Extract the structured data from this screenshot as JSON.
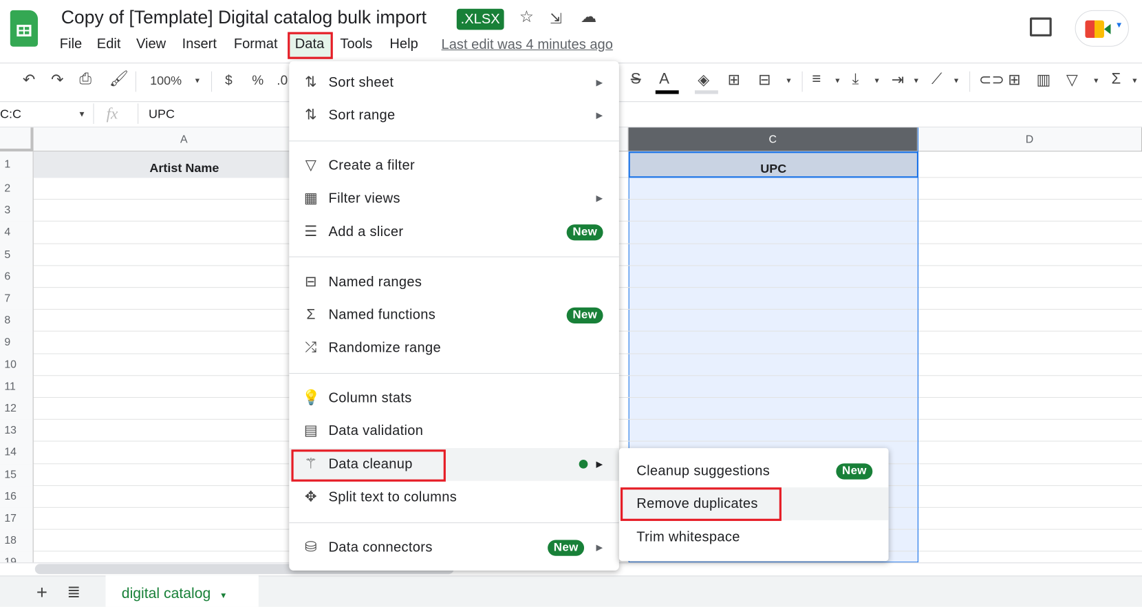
{
  "header": {
    "title": "Copy of [Template] Digital catalog bulk import",
    "file_badge": ".XLSX",
    "last_edit": "Last edit was 4 minutes ago"
  },
  "menubar": [
    "File",
    "Edit",
    "View",
    "Insert",
    "Format",
    "Data",
    "Tools",
    "Help"
  ],
  "toolbar": {
    "zoom": "100%",
    "currency": "$",
    "percent": "%",
    "decimal": ".0"
  },
  "formula_bar": {
    "name_box": "C:C",
    "fx": "fx",
    "value": "UPC"
  },
  "columns": [
    "A",
    "C",
    "D"
  ],
  "rows": [
    "1",
    "2",
    "3",
    "4",
    "5",
    "6",
    "7",
    "8",
    "9",
    "10",
    "11",
    "12",
    "13",
    "14",
    "15",
    "16",
    "17",
    "18",
    "19"
  ],
  "cells": {
    "A1": "Artist Name",
    "C1": "UPC"
  },
  "data_menu": {
    "items": [
      {
        "label": "Sort sheet",
        "icon": "sort-icon",
        "submenu": true
      },
      {
        "label": "Sort range",
        "icon": "sort-icon",
        "submenu": true
      },
      {
        "label": "Create a filter",
        "icon": "filter-icon"
      },
      {
        "label": "Filter views",
        "icon": "filter-views-icon",
        "submenu": true
      },
      {
        "label": "Add a slicer",
        "icon": "slicer-icon",
        "badge": "New"
      },
      {
        "label": "Named ranges",
        "icon": "named-ranges-icon"
      },
      {
        "label": "Named functions",
        "icon": "sigma-icon",
        "badge": "New"
      },
      {
        "label": "Randomize range",
        "icon": "shuffle-icon"
      },
      {
        "label": "Column stats",
        "icon": "lightbulb-icon"
      },
      {
        "label": "Data validation",
        "icon": "data-validation-icon"
      },
      {
        "label": "Data cleanup",
        "icon": "magic-wand-icon",
        "submenu": true,
        "highlighted": true
      },
      {
        "label": "Split text to columns",
        "icon": "split-icon"
      },
      {
        "label": "Data connectors",
        "icon": "database-icon",
        "badge": "New",
        "submenu": true
      }
    ]
  },
  "cleanup_submenu": {
    "items": [
      {
        "label": "Cleanup suggestions",
        "badge": "New"
      },
      {
        "label": "Remove duplicates",
        "highlighted": true
      },
      {
        "label": "Trim whitespace"
      }
    ]
  },
  "sheet_tabs": [
    {
      "label": "digital catalog",
      "active": true
    }
  ],
  "colors": {
    "accent": "#188038",
    "highlight_box": "#e61d26",
    "selection": "#1a73e8",
    "selection_fill": "#e8f0fe"
  }
}
